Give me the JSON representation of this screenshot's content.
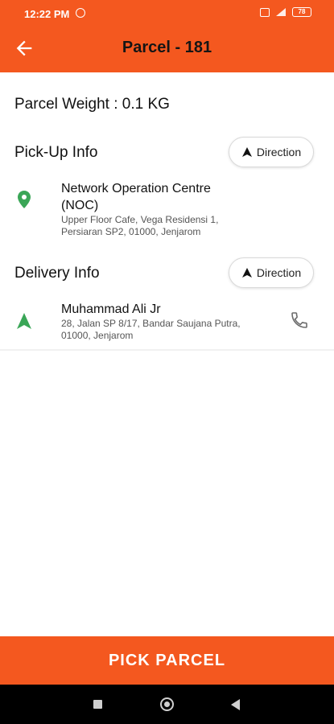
{
  "status_bar": {
    "time": "12:22 PM",
    "battery": "78",
    "icons": [
      "whatsapp-icon",
      "notification-icon",
      "signal-icon",
      "battery-icon"
    ]
  },
  "header": {
    "title": "Parcel - 181",
    "back_icon": "arrow-left-icon",
    "color": "#f4581f"
  },
  "parcel": {
    "weight_text": "Parcel Weight : 0.1 KG"
  },
  "pickup": {
    "section_title": "Pick-Up Info",
    "direction_label": "Direction",
    "name_line1": "Network Operation Centre",
    "name_line2": "(NOC)",
    "address_line1": "Upper Floor Cafe, Vega Residensi 1,",
    "address_line2": "Persiaran SP2, 01000, Jenjarom",
    "icon": "location-pin-icon",
    "icon_color": "#3aa657"
  },
  "delivery": {
    "section_title": "Delivery Info",
    "direction_label": "Direction",
    "name": "Muhammad Ali Jr",
    "address_line1": "28, Jalan SP 8/17, Bandar Saujana Putra,",
    "address_line2": "01000, Jenjarom",
    "icon": "navigation-arrow-icon",
    "icon_color": "#3aa657",
    "phone_icon": "phone-icon"
  },
  "footer": {
    "action_label": "PICK PARCEL"
  },
  "system_nav": {
    "icons": [
      "recent-apps-icon",
      "home-icon",
      "back-icon"
    ]
  }
}
